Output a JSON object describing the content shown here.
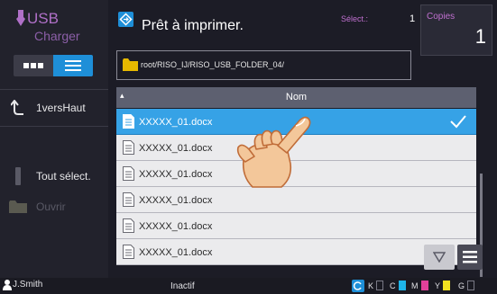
{
  "sidebar": {
    "usb_title": "USB",
    "usb_subtitle": "Charger",
    "up_button": "1versHaut",
    "select_all": "Tout sélect.",
    "open": "Ouvrir"
  },
  "header": {
    "title": "Prêt à imprimer.",
    "selected_label": "Sélect.:",
    "selected_count": "1",
    "copies_label": "Copies",
    "copies_value": "1"
  },
  "path": "root/RISO_IJ/RISO_USB_FOLDER_04/",
  "list": {
    "column_header": "Nom",
    "files": [
      {
        "name": "XXXXX_01.docx",
        "selected": true
      },
      {
        "name": "XXXXX_01.docx",
        "selected": false
      },
      {
        "name": "XXXXX_01.docx",
        "selected": false
      },
      {
        "name": "XXXXX_01.docx",
        "selected": false
      },
      {
        "name": "XXXXX_01.docx",
        "selected": false
      },
      {
        "name": "XXXXX_01.docx",
        "selected": false
      }
    ]
  },
  "status": {
    "user": "J.Smith",
    "state": "Inactif",
    "inks": [
      {
        "label": "K",
        "color": "#ffffff"
      },
      {
        "label": "C",
        "color": "#1eb4e8"
      },
      {
        "label": "M",
        "color": "#e0409a"
      },
      {
        "label": "Y",
        "color": "#f0e020"
      },
      {
        "label": "G",
        "color": "#ffffff"
      }
    ]
  },
  "colors": {
    "accent": "#1e8fd8",
    "purple": "#b070c8",
    "selected_row": "#36a2e6"
  }
}
